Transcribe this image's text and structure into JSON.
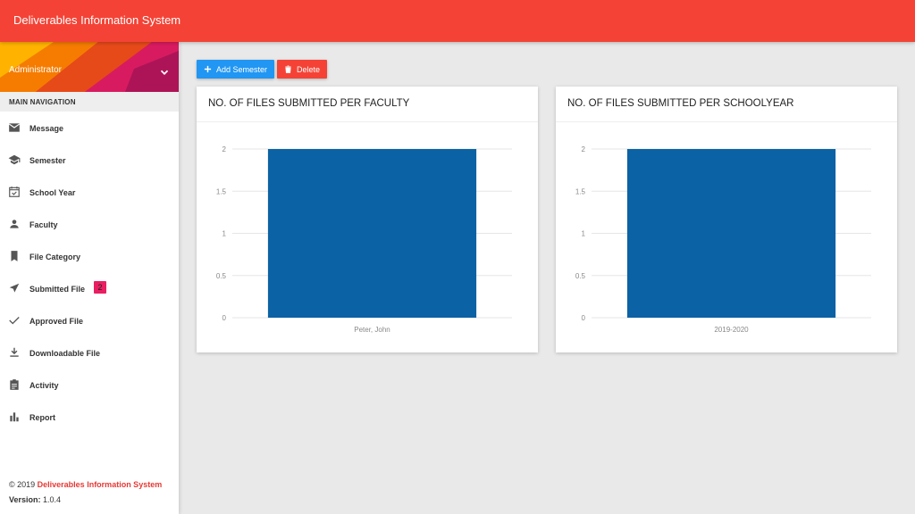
{
  "app": {
    "title": "Deliverables Information System"
  },
  "user": {
    "name": "Administrator"
  },
  "nav": {
    "header": "MAIN NAVIGATION",
    "items": [
      {
        "label": "Message",
        "icon": "mail-icon"
      },
      {
        "label": "Semester",
        "icon": "school-icon"
      },
      {
        "label": "School Year",
        "icon": "calendar-icon"
      },
      {
        "label": "Faculty",
        "icon": "person-icon"
      },
      {
        "label": "File Category",
        "icon": "bookmark-icon"
      },
      {
        "label": "Submitted File",
        "icon": "send-icon",
        "badge": "2"
      },
      {
        "label": "Approved File",
        "icon": "check-icon"
      },
      {
        "label": "Downloadable File",
        "icon": "download-icon"
      },
      {
        "label": "Activity",
        "icon": "assignment-icon"
      },
      {
        "label": "Report",
        "icon": "bar-chart-icon"
      }
    ]
  },
  "footer": {
    "copyright": "© 2019 ",
    "brand": "Deliverables Information System",
    "version_label": "Version:",
    "version": " 1.0.4"
  },
  "toolbar": {
    "add_label": "Add Semester",
    "delete_label": "Delete"
  },
  "colors": {
    "topbar": "#f44336",
    "bar": "#0b62a4",
    "add_button": "#2196f3",
    "delete_button": "#f44336",
    "badge": "#e91e63"
  },
  "chart_data": [
    {
      "type": "bar",
      "title": "NO. OF FILES SUBMITTED PER FACULTY",
      "categories": [
        "Peter, John"
      ],
      "values": [
        2
      ],
      "ylim": [
        0,
        2
      ],
      "yticks": [
        "0",
        "0.5",
        "1",
        "1.5",
        "2"
      ],
      "grid": true
    },
    {
      "type": "bar",
      "title": "NO. OF FILES SUBMITTED PER SCHOOLYEAR",
      "categories": [
        "2019-2020"
      ],
      "values": [
        2
      ],
      "ylim": [
        0,
        2
      ],
      "yticks": [
        "0",
        "0.5",
        "1",
        "1.5",
        "2"
      ],
      "grid": true
    }
  ]
}
